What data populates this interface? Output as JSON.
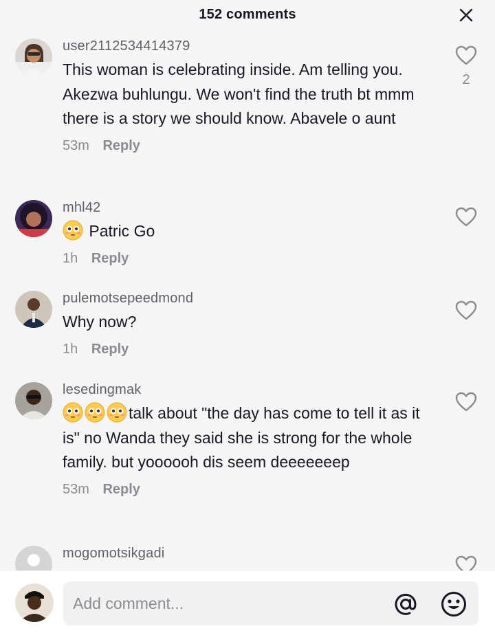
{
  "header": {
    "title": "152 comments",
    "close_icon": "close-icon"
  },
  "comments": [
    {
      "username": "user2112534414379",
      "text": "This woman is celebrating inside. Am telling you. Akezwa buhlungu. We won't find the truth bt mmm there is a story we should know. Abavele o aunt",
      "time": "53m",
      "reply": "Reply",
      "likes": "2"
    },
    {
      "username": "mhl42",
      "text": "Patric Go",
      "emoji": "flushed-face",
      "time": "1h",
      "reply": "Reply",
      "likes": ""
    },
    {
      "username": "pulemotsepeedmond",
      "text": "Why now?",
      "time": "1h",
      "reply": "Reply",
      "likes": ""
    },
    {
      "username": "lesedingmak",
      "text": "talk about \"the day has come to tell it as it is\" no Wanda they said she is strong for the whole family. but yoooooh dis seem deeeeeeep",
      "emoji": "flushed-face x3",
      "time": "53m",
      "reply": "Reply",
      "likes": ""
    },
    {
      "username": "mogomotsikgadi"
    }
  ],
  "composer": {
    "placeholder": "Add comment...",
    "mention_icon": "at-sign-icon",
    "emoji_icon": "smiley-icon"
  },
  "colors": {
    "background": "#f5f5f6",
    "text": "#161823",
    "muted": "#8a8b91"
  }
}
